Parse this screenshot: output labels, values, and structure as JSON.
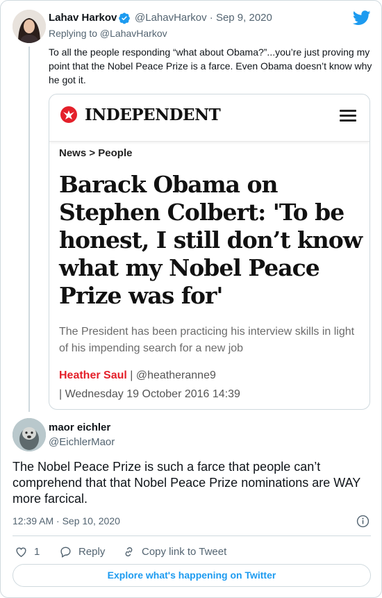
{
  "tweet1": {
    "author_name": "Lahav Harkov",
    "handle": "@LahavHarkov",
    "separator": "·",
    "date": "Sep 9, 2020",
    "replying_to": "Replying to @LahavHarkov",
    "text": "To all the people responding “what about Obama?”...you’re just proving my point that the Nobel Peace Prize is a farce. Even Obama doesn’t know why he got it."
  },
  "card": {
    "brand": "INDEPENDENT",
    "breadcrumb": "News > People",
    "headline": "Barack Obama on Stephen Colbert: 'To be honest, I still don’t know what my Nobel Peace Prize was for'",
    "standfirst": "The President has been practicing his interview skills in light of his impending search for a new job",
    "author": "Heather Saul",
    "author_handle": " | @heatheranne9",
    "date": "| Wednesday 19 October 2016 14:39",
    "brand_color": "#e4202a"
  },
  "tweet2": {
    "author_name": "maor eichler",
    "handle": "@EichlerMaor",
    "text": "The Nobel Peace Prize is such a farce that people can’t comprehend that that Nobel Peace Prize nominations are WAY more farcical.",
    "timestamp": "12:39 AM · Sep 10, 2020",
    "like_count": "1",
    "reply_label": "Reply",
    "copy_link_label": "Copy link to Tweet"
  },
  "explore_label": "Explore what's happening on Twitter",
  "accent_color": "#1d9bf0",
  "icons": [
    "verified-badge-icon",
    "twitter-bird-icon",
    "independent-eagle-icon",
    "hamburger-menu-icon",
    "info-icon",
    "heart-icon",
    "reply-icon",
    "link-icon"
  ]
}
